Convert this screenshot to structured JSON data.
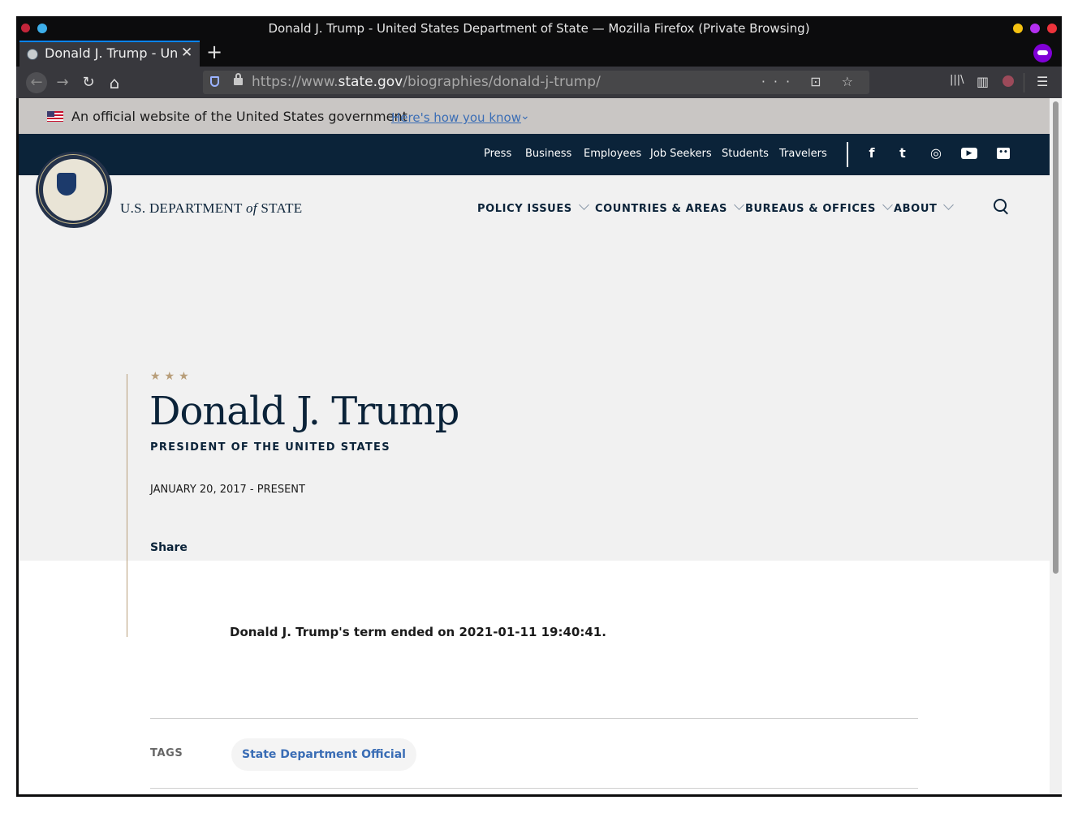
{
  "window": {
    "title": "Donald J. Trump - United States Department of State — Mozilla Firefox (Private Browsing)"
  },
  "tab": {
    "label": "Donald J. Trump - United States Department of State",
    "close": "✕"
  },
  "newtab": "+",
  "urlbar": {
    "prefix": "https://www.",
    "host": "state.gov",
    "path": "/biographies/donald-j-trump/",
    "actions": "··· ⊡ ☆"
  },
  "icons": {
    "back": "←",
    "forward": "→",
    "reload": "↻",
    "home": "⌂",
    "library": "|||\\",
    "sidebar": "▥",
    "menu": "☰"
  },
  "banner": {
    "text": "An official website of the United States government",
    "link": "Here's how you know",
    "chevron": "⌄"
  },
  "topnav": {
    "links": [
      "Press",
      "Business",
      "Employees",
      "Job Seekers",
      "Students",
      "Travelers"
    ],
    "social": {
      "facebook": "f",
      "twitter": "t",
      "instagram": "◎",
      "youtube": "▶",
      "flickr": "••"
    }
  },
  "header": {
    "dept_prefix": "U.S. DEPARTMENT",
    "dept_of": "of",
    "dept_suffix": "STATE",
    "menu": [
      "POLICY ISSUES",
      "COUNTRIES & AREAS",
      "BUREAUS & OFFICES",
      "ABOUT"
    ]
  },
  "bio": {
    "stars": "★★★",
    "name": "Donald J. Trump",
    "role": "PRESIDENT OF THE UNITED STATES",
    "dates": "JANUARY 20, 2017 - PRESENT",
    "share": "Share"
  },
  "body": {
    "term_text": "Donald J. Trump's term ended on 2021-01-11 19:40:41."
  },
  "tags": {
    "label": "TAGS",
    "items": [
      "State Department Official"
    ]
  },
  "colors": {
    "navy": "#0b2339",
    "gold": "#b89e7a",
    "link": "#3a6db5",
    "private": "#8000d7"
  }
}
